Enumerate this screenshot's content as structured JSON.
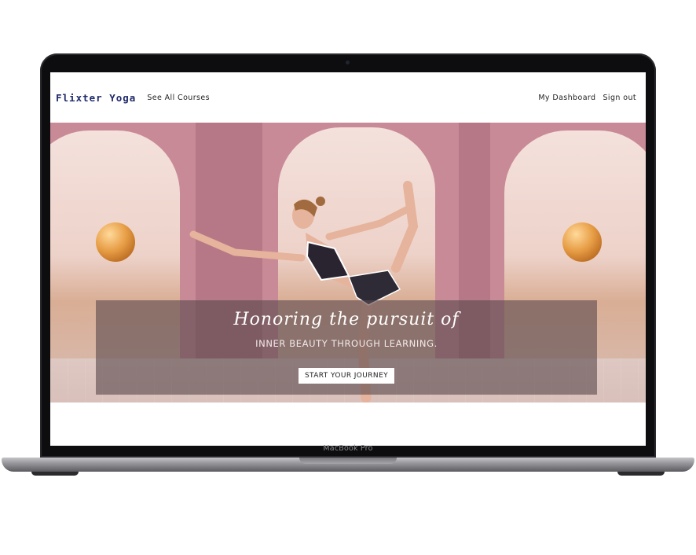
{
  "site": {
    "logo": "Flixter Yoga",
    "nav_left": {
      "courses_label": "See All Courses"
    },
    "nav_right": {
      "dashboard_label": "My Dashboard",
      "signout_label": "Sign out"
    }
  },
  "hero": {
    "headline": "Honoring the pursuit of",
    "subheadline": "INNER BEAUTY THROUGH LEARNING.",
    "cta_label": "START YOUR JOURNEY"
  },
  "device": {
    "model_label": "MacBook Pro"
  },
  "colors": {
    "logo": "#1f2a6b",
    "arch": "#c98a97",
    "overlay": "#5c4a4e",
    "sphere": "#e79d45"
  }
}
